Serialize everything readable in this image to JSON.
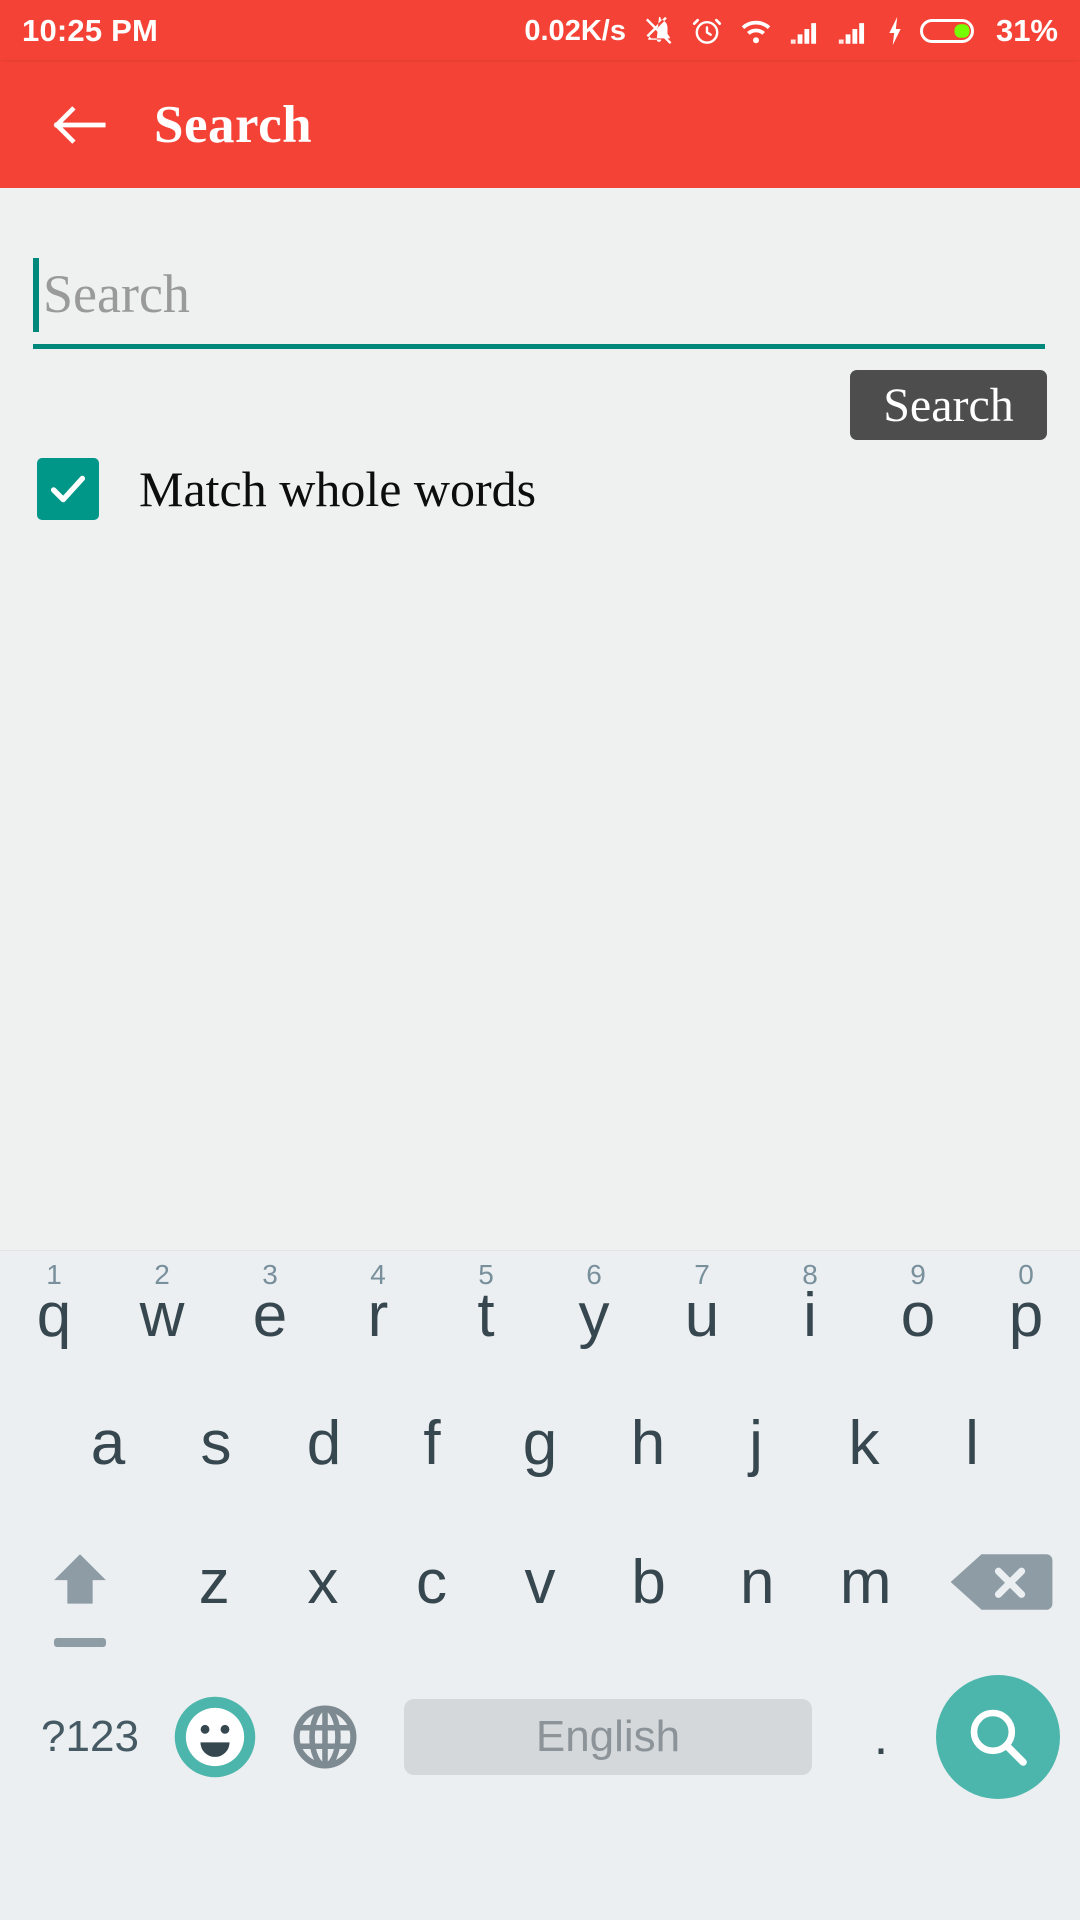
{
  "status_bar": {
    "time": "10:25 PM",
    "network_speed": "0.02K/s",
    "battery_percent": "31%",
    "icons": [
      "mute-bell-icon",
      "alarm-clock-icon",
      "wifi-icon",
      "signal-bars-icon",
      "signal-bars-icon",
      "charging-bolt-icon",
      "battery-icon"
    ],
    "background_color": "#f44336",
    "foreground_color": "#ffffff"
  },
  "app_bar": {
    "title": "Search",
    "back_icon": "arrow-left-icon",
    "background_color": "#f44336"
  },
  "main": {
    "search_field": {
      "value": "",
      "placeholder": "Search",
      "underline_color": "#00897b",
      "caret_color": "#00897b"
    },
    "search_button": {
      "label": "Search",
      "background_color": "#4d4d4d",
      "text_color": "#ffffff"
    },
    "match_whole_words": {
      "label": "Match whole words",
      "checked": true,
      "check_color": "#009688"
    },
    "background_color": "#eff1f1"
  },
  "keyboard": {
    "background_color": "#eceff1",
    "row1": [
      {
        "letter": "q",
        "num": "1"
      },
      {
        "letter": "w",
        "num": "2"
      },
      {
        "letter": "e",
        "num": "3"
      },
      {
        "letter": "r",
        "num": "4"
      },
      {
        "letter": "t",
        "num": "5"
      },
      {
        "letter": "y",
        "num": "6"
      },
      {
        "letter": "u",
        "num": "7"
      },
      {
        "letter": "i",
        "num": "8"
      },
      {
        "letter": "o",
        "num": "9"
      },
      {
        "letter": "p",
        "num": "0"
      }
    ],
    "row2": [
      "a",
      "s",
      "d",
      "f",
      "g",
      "h",
      "j",
      "k",
      "l"
    ],
    "row3": [
      "z",
      "x",
      "c",
      "v",
      "b",
      "n",
      "m"
    ],
    "shift_icon": "shift-arrow-icon",
    "backspace_icon": "backspace-icon",
    "function_row": {
      "symbols_label": "?123",
      "emoji_icon": "emoji-smiley-icon",
      "globe_icon": "language-globe-icon",
      "spacebar_label": "English",
      "period_label": ".",
      "enter_icon": "search-magnifier-icon",
      "enter_color": "#4db6ac",
      "emoji_color": "#4db6ac",
      "spacebar_color": "#d4d8da"
    }
  }
}
